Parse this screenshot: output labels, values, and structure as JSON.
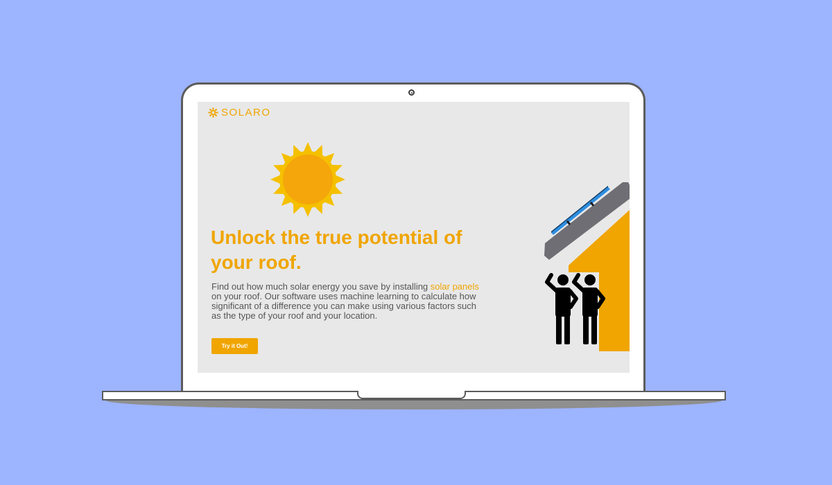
{
  "brand": {
    "name": "SOLARO",
    "icon": "gear-sun-icon",
    "color": "#f0a500"
  },
  "hero": {
    "headline": "Unlock the true potential of your roof.",
    "description_before": "Find out how much solar energy you save by installing ",
    "description_highlight": "solar panels",
    "description_after": " on your roof. Our software uses machine learning to calculate how significant of a difference you can make using various factors such as the type of your roof and your location.",
    "cta_label": "Try it Out!"
  },
  "illustrations": {
    "sun": "sun-icon",
    "house": "house-with-solar-panel-illustration",
    "people": "cheering-people-icon"
  },
  "colors": {
    "background": "#9db4ff",
    "screen": "#e8e8e8",
    "accent": "#f0a500",
    "text": "#555555",
    "roof": "#6e6e74",
    "panel": "#2c8ee0"
  }
}
